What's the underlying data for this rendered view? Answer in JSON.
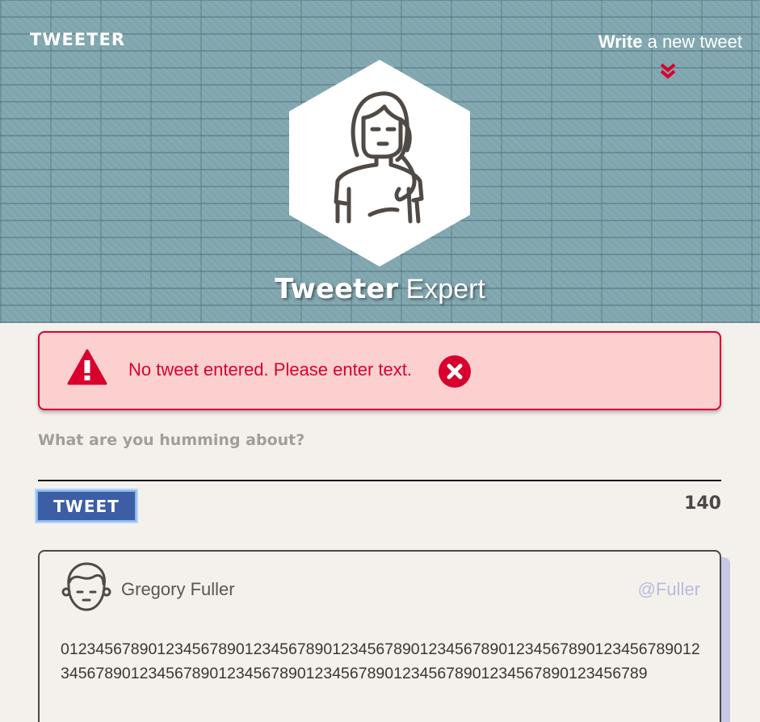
{
  "header": {
    "logo": "TWEETER",
    "write_link_bold": "Write",
    "write_link_rest": " a new tweet",
    "title_bold": "Tweeter",
    "title_light": " Expert"
  },
  "alert": {
    "message": "No tweet entered. Please enter text."
  },
  "compose": {
    "placeholder": "What are you humming about?",
    "value": "",
    "tweet_button_label": "TWEET",
    "char_count": "140"
  },
  "tweet": {
    "user_name": "Gregory Fuller",
    "handle": "@Fuller",
    "text": "01234567890123456789012345678901234567890123456789012345678901234567890123456789012345678901234567890123456789012345678901234567890123456789"
  },
  "colors": {
    "accent_red": "#d9002e",
    "alert_bg": "#fdd0d0",
    "button_blue": "#3c5ea4",
    "handle_color": "#b6bcde",
    "header_bg": "#7fa5ae",
    "page_bg": "#f4f1ec"
  },
  "icons": {
    "nav_chevron": "double-chevron-down-icon",
    "profile": "woman-avatar-icon",
    "alert_warning": "warning-triangle-icon",
    "alert_close": "close-circle-icon",
    "tweet_avatar": "man-avatar-icon"
  }
}
